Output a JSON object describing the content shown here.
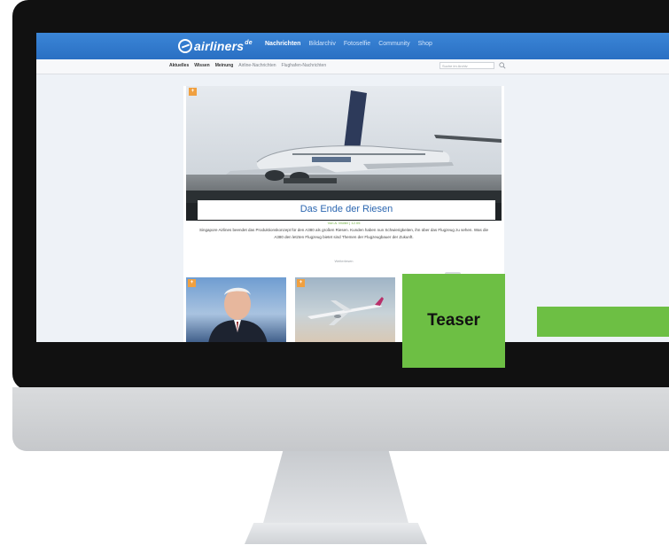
{
  "site": {
    "logo_text": "airliners",
    "logo_suffix": "de"
  },
  "main_nav": {
    "items": [
      "Nachrichten",
      "Bildarchiv",
      "Fotoselfie",
      "Community",
      "Shop"
    ]
  },
  "sub_nav": {
    "items": [
      "Aktuelles",
      "Wissen",
      "Meinung",
      "Airline-Nachrichten",
      "Flughafen-Nachrichten"
    ]
  },
  "search": {
    "placeholder": "Suche im Archiv"
  },
  "hero_article": {
    "badge": "+",
    "title": "Das Ende der Riesen",
    "meta": "Von A. Müller | 12.05",
    "teaser": "Singapore Airlines beendet das Produktionskonzept für den A380 als großen Riesen. Kunden haben nun Schwierigkeiten, ihn über das Flugzeug zu sehen. Was die A380 den letzten Flugzeug bietet sind Themen der Flugzeugbauer der Zukunft.",
    "more": "Weiterlesen"
  },
  "thumbnails": [
    {
      "badge": "+"
    },
    {
      "badge": "+"
    }
  ],
  "overlay": {
    "teaser_label": "Teaser",
    "accent_color": "#6dbf44"
  },
  "colors": {
    "topbar": "#2a6fc3",
    "title_blue": "#2b66b0",
    "badge_orange": "#f0a040"
  }
}
